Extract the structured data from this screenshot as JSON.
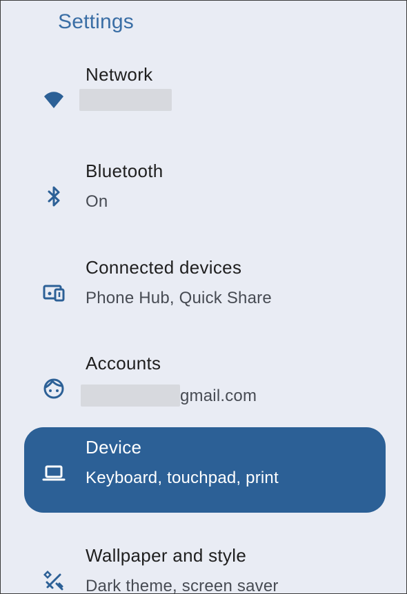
{
  "header": {
    "title": "Settings"
  },
  "colors": {
    "accent": "#2c6096",
    "icon": "#2c6096",
    "background": "#e9ecf4",
    "title": "#3a6ea5"
  },
  "items": [
    {
      "label": "Network",
      "subtitle": "",
      "icon": "wifi-icon",
      "selected": false
    },
    {
      "label": "Bluetooth",
      "subtitle": "On",
      "icon": "bluetooth-icon",
      "selected": false
    },
    {
      "label": "Connected devices",
      "subtitle": "Phone Hub, Quick Share",
      "icon": "connected-devices-icon",
      "selected": false
    },
    {
      "label": "Accounts",
      "subtitle": "gmail.com",
      "icon": "account-face-icon",
      "selected": false
    },
    {
      "label": "Device",
      "subtitle": "Keyboard, touchpad, print",
      "icon": "laptop-icon",
      "selected": true
    },
    {
      "label": "Wallpaper and style",
      "subtitle": "Dark theme, screen saver",
      "icon": "paint-brush-icon",
      "selected": false
    }
  ]
}
